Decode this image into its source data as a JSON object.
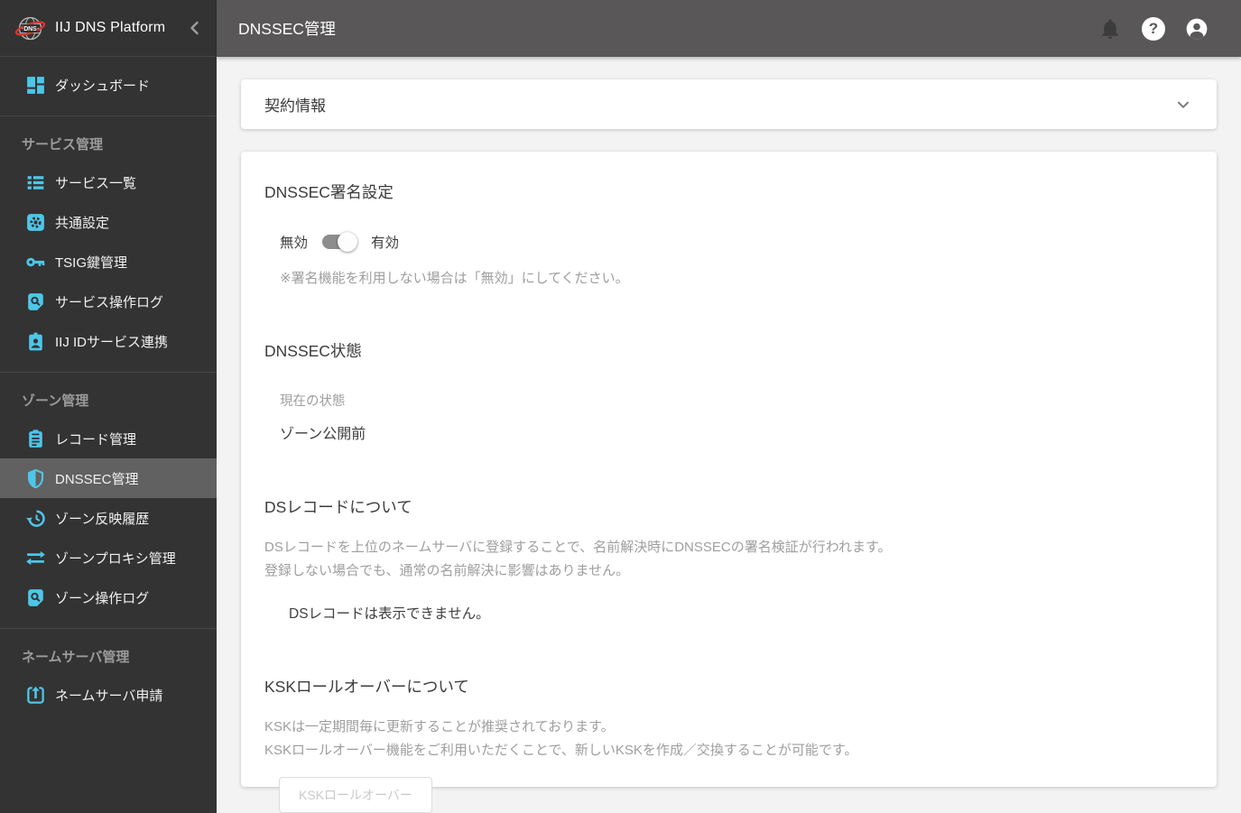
{
  "app": {
    "title": "IIJ DNS Platform",
    "logo_text": "DNS"
  },
  "header": {
    "title": "DNSSEC管理",
    "help_glyph": "?"
  },
  "sidebar": {
    "dashboard": {
      "label": "ダッシュボード",
      "icon": "dashboard-icon"
    },
    "sections": [
      {
        "label": "サービス管理",
        "items": [
          {
            "label": "サービス一覧",
            "icon": "list-icon"
          },
          {
            "label": "共通設定",
            "icon": "settings-icon"
          },
          {
            "label": "TSIG鍵管理",
            "icon": "key-icon"
          },
          {
            "label": "サービス操作ログ",
            "icon": "log-search-icon"
          },
          {
            "label": "IIJ IDサービス連携",
            "icon": "id-badge-icon"
          }
        ]
      },
      {
        "label": "ゾーン管理",
        "items": [
          {
            "label": "レコード管理",
            "icon": "clipboard-icon"
          },
          {
            "label": "DNSSEC管理",
            "icon": "shield-icon",
            "active": true
          },
          {
            "label": "ゾーン反映履歴",
            "icon": "history-icon"
          },
          {
            "label": "ゾーンプロキシ管理",
            "icon": "swap-icon"
          },
          {
            "label": "ゾーン操作ログ",
            "icon": "log-search-icon"
          }
        ]
      },
      {
        "label": "ネームサーバ管理",
        "items": [
          {
            "label": "ネームサーバ申請",
            "icon": "upload-box-icon"
          }
        ]
      }
    ]
  },
  "contract_card": {
    "title": "契約情報"
  },
  "dnssec_card": {
    "signing": {
      "heading": "DNSSEC署名設定",
      "toggle_off_label": "無効",
      "toggle_on_label": "有効",
      "toggle_state": "無効",
      "note": "※署名機能を利用しない場合は「無効」にしてください。"
    },
    "status": {
      "heading": "DNSSEC状態",
      "label": "現在の状態",
      "value": "ゾーン公開前"
    },
    "ds_record": {
      "heading": "DSレコードについて",
      "line1": "DSレコードを上位のネームサーバに登録することで、名前解決時にDNSSECの署名検証が行われます。",
      "line2": "登録しない場合でも、通常の名前解決に影響はありません。",
      "message": "DSレコードは表示できません。"
    },
    "ksk": {
      "heading": "KSKロールオーバーについて",
      "line1": "KSKは一定期間毎に更新することが推奨されております。",
      "line2": "KSKロールオーバー機能をご利用いただくことで、新しいKSKを作成／交換することが可能です。",
      "button_label": "KSKロールオーバー",
      "button_disabled": true
    }
  },
  "colors": {
    "accent_cyan": "#4ec6e8",
    "logo_red": "#d7372e",
    "sidebar_bg": "#333333",
    "sidebar_active_bg": "#616161",
    "header_bg": "#595757",
    "content_bg": "#f3f3f3",
    "muted_text": "#9e9e9e"
  }
}
